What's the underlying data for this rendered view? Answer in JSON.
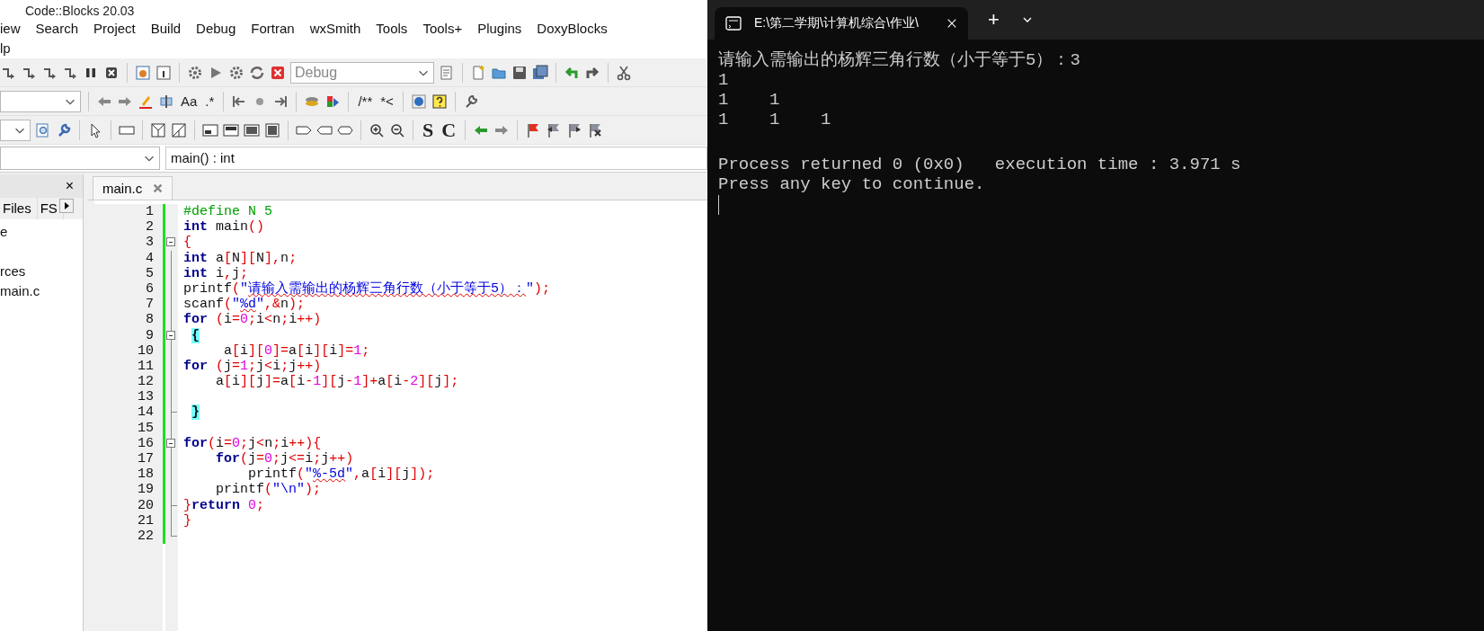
{
  "window": {
    "title": "Code::Blocks 20.03"
  },
  "menu": {
    "items": [
      "iew",
      "Search",
      "Project",
      "Build",
      "Debug",
      "Fortran",
      "wxSmith",
      "Tools",
      "Tools+",
      "Plugins",
      "DoxyBlocks"
    ],
    "second_row": [
      "lp"
    ]
  },
  "toolbars": [
    {
      "texts": [
        "Debug"
      ]
    },
    {
      "texts": [
        "Aa",
        ".*",
        "/**",
        "*<"
      ]
    },
    {
      "texts": [
        "S",
        "C"
      ]
    }
  ],
  "function_field": {
    "value": "main() : int"
  },
  "management": {
    "close_glyph": "×",
    "tabs": [
      {
        "label": "Files",
        "selected": false
      },
      {
        "label": "FS",
        "selected": false
      }
    ],
    "tree": [
      "e",
      "rces",
      "main.c"
    ]
  },
  "editor": {
    "tab": {
      "label": "main.c",
      "selected": true
    },
    "lines": [
      {
        "number": "1",
        "segs": [
          {
            "kind": "pp",
            "text": "#define N 5"
          }
        ]
      },
      {
        "number": "2",
        "segs": [
          {
            "kind": "kw",
            "text": "int"
          },
          {
            "kind": "id",
            "text": " main"
          },
          {
            "kind": "op",
            "text": "()"
          }
        ]
      },
      {
        "number": "3",
        "fold_start": true,
        "segs": [
          {
            "kind": "op",
            "text": "{"
          }
        ]
      },
      {
        "number": "4",
        "segs": [
          {
            "kind": "kw",
            "text": "int"
          },
          {
            "kind": "id",
            "text": " a"
          },
          {
            "kind": "op",
            "text": "["
          },
          {
            "kind": "id",
            "text": "N"
          },
          {
            "kind": "op",
            "text": "]["
          },
          {
            "kind": "id",
            "text": "N"
          },
          {
            "kind": "op",
            "text": "],"
          },
          {
            "kind": "id",
            "text": "n"
          },
          {
            "kind": "op",
            "text": ";"
          }
        ]
      },
      {
        "number": "5",
        "segs": [
          {
            "kind": "kw",
            "text": "int"
          },
          {
            "kind": "id",
            "text": " i"
          },
          {
            "kind": "op",
            "text": ","
          },
          {
            "kind": "id",
            "text": "j"
          },
          {
            "kind": "op",
            "text": ";"
          }
        ]
      },
      {
        "number": "6",
        "segs": [
          {
            "kind": "id",
            "text": "printf"
          },
          {
            "kind": "op",
            "text": "("
          },
          {
            "kind": "str",
            "text": "\""
          },
          {
            "kind": "flag",
            "text": "请输入需输出的杨辉三角行数（小于等于5）："
          },
          {
            "kind": "str",
            "text": "\""
          },
          {
            "kind": "op",
            "text": ");"
          }
        ]
      },
      {
        "number": "7",
        "segs": [
          {
            "kind": "id",
            "text": "scanf"
          },
          {
            "kind": "op",
            "text": "("
          },
          {
            "kind": "str",
            "text": "\""
          },
          {
            "kind": "flag",
            "text": "%d"
          },
          {
            "kind": "str",
            "text": "\""
          },
          {
            "kind": "op",
            "text": ",&"
          },
          {
            "kind": "id",
            "text": "n"
          },
          {
            "kind": "op",
            "text": ");"
          }
        ]
      },
      {
        "number": "8",
        "segs": [
          {
            "kind": "kw",
            "text": "for"
          },
          {
            "kind": "op",
            "text": " ("
          },
          {
            "kind": "id",
            "text": "i"
          },
          {
            "kind": "op",
            "text": "="
          },
          {
            "kind": "num",
            "text": "0"
          },
          {
            "kind": "op",
            "text": ";"
          },
          {
            "kind": "id",
            "text": "i"
          },
          {
            "kind": "op",
            "text": "<"
          },
          {
            "kind": "id",
            "text": "n"
          },
          {
            "kind": "op",
            "text": ";"
          },
          {
            "kind": "id",
            "text": "i"
          },
          {
            "kind": "op",
            "text": "++)"
          }
        ]
      },
      {
        "number": "9",
        "fold_start": true,
        "segs": [
          {
            "kind": "brace",
            "text": "{"
          }
        ]
      },
      {
        "number": "10",
        "segs": [
          {
            "kind": "id",
            "text": "     a"
          },
          {
            "kind": "op",
            "text": "["
          },
          {
            "kind": "id",
            "text": "i"
          },
          {
            "kind": "op",
            "text": "]["
          },
          {
            "kind": "num",
            "text": "0"
          },
          {
            "kind": "op",
            "text": "]="
          },
          {
            "kind": "id",
            "text": "a"
          },
          {
            "kind": "op",
            "text": "["
          },
          {
            "kind": "id",
            "text": "i"
          },
          {
            "kind": "op",
            "text": "]["
          },
          {
            "kind": "id",
            "text": "i"
          },
          {
            "kind": "op",
            "text": "]="
          },
          {
            "kind": "num",
            "text": "1"
          },
          {
            "kind": "op",
            "text": ";"
          }
        ]
      },
      {
        "number": "11",
        "segs": [
          {
            "kind": "kw",
            "text": "for"
          },
          {
            "kind": "op",
            "text": " ("
          },
          {
            "kind": "id",
            "text": "j"
          },
          {
            "kind": "op",
            "text": "="
          },
          {
            "kind": "num",
            "text": "1"
          },
          {
            "kind": "op",
            "text": ";"
          },
          {
            "kind": "id",
            "text": "j"
          },
          {
            "kind": "op",
            "text": "<"
          },
          {
            "kind": "id",
            "text": "i"
          },
          {
            "kind": "op",
            "text": ";"
          },
          {
            "kind": "id",
            "text": "j"
          },
          {
            "kind": "op",
            "text": "++)"
          }
        ]
      },
      {
        "number": "12",
        "segs": [
          {
            "kind": "id",
            "text": "    a"
          },
          {
            "kind": "op",
            "text": "["
          },
          {
            "kind": "id",
            "text": "i"
          },
          {
            "kind": "op",
            "text": "]["
          },
          {
            "kind": "id",
            "text": "j"
          },
          {
            "kind": "op",
            "text": "]="
          },
          {
            "kind": "id",
            "text": "a"
          },
          {
            "kind": "op",
            "text": "["
          },
          {
            "kind": "id",
            "text": "i"
          },
          {
            "kind": "op",
            "text": "-"
          },
          {
            "kind": "num",
            "text": "1"
          },
          {
            "kind": "op",
            "text": "]["
          },
          {
            "kind": "id",
            "text": "j"
          },
          {
            "kind": "op",
            "text": "-"
          },
          {
            "kind": "num",
            "text": "1"
          },
          {
            "kind": "op",
            "text": "]+"
          },
          {
            "kind": "id",
            "text": "a"
          },
          {
            "kind": "op",
            "text": "["
          },
          {
            "kind": "id",
            "text": "i"
          },
          {
            "kind": "op",
            "text": "-"
          },
          {
            "kind": "num",
            "text": "2"
          },
          {
            "kind": "op",
            "text": "]["
          },
          {
            "kind": "id",
            "text": "j"
          },
          {
            "kind": "op",
            "text": "];"
          }
        ]
      },
      {
        "number": "13"
      },
      {
        "number": "14",
        "fold_end": true,
        "segs": [
          {
            "kind": "brace",
            "text": "}"
          }
        ]
      },
      {
        "number": "15"
      },
      {
        "number": "16",
        "fold_start": true,
        "segs": [
          {
            "kind": "kw",
            "text": "for"
          },
          {
            "kind": "op",
            "text": "("
          },
          {
            "kind": "id",
            "text": "i"
          },
          {
            "kind": "op",
            "text": "="
          },
          {
            "kind": "num",
            "text": "0"
          },
          {
            "kind": "op",
            "text": ";"
          },
          {
            "kind": "id",
            "text": "j"
          },
          {
            "kind": "op",
            "text": "<"
          },
          {
            "kind": "id",
            "text": "n"
          },
          {
            "kind": "op",
            "text": ";"
          },
          {
            "kind": "id",
            "text": "i"
          },
          {
            "kind": "op",
            "text": "++){"
          }
        ]
      },
      {
        "number": "17",
        "segs": [
          {
            "kind": "kw",
            "text": "    for"
          },
          {
            "kind": "op",
            "text": "("
          },
          {
            "kind": "id",
            "text": "j"
          },
          {
            "kind": "op",
            "text": "="
          },
          {
            "kind": "num",
            "text": "0"
          },
          {
            "kind": "op",
            "text": ";"
          },
          {
            "kind": "id",
            "text": "j"
          },
          {
            "kind": "op",
            "text": "<="
          },
          {
            "kind": "id",
            "text": "i"
          },
          {
            "kind": "op",
            "text": ";"
          },
          {
            "kind": "id",
            "text": "j"
          },
          {
            "kind": "op",
            "text": "++)"
          }
        ]
      },
      {
        "number": "18",
        "segs": [
          {
            "kind": "id",
            "text": "        printf"
          },
          {
            "kind": "op",
            "text": "("
          },
          {
            "kind": "str",
            "text": "\""
          },
          {
            "kind": "flag",
            "text": "%-5d"
          },
          {
            "kind": "str",
            "text": "\""
          },
          {
            "kind": "op",
            "text": ","
          },
          {
            "kind": "id",
            "text": "a"
          },
          {
            "kind": "op",
            "text": "["
          },
          {
            "kind": "id",
            "text": "i"
          },
          {
            "kind": "op",
            "text": "]["
          },
          {
            "kind": "id",
            "text": "j"
          },
          {
            "kind": "op",
            "text": "]);"
          }
        ]
      },
      {
        "number": "19",
        "segs": [
          {
            "kind": "id",
            "text": "    printf"
          },
          {
            "kind": "op",
            "text": "("
          },
          {
            "kind": "str",
            "text": "\"\\n\""
          },
          {
            "kind": "op",
            "text": ");"
          }
        ]
      },
      {
        "number": "20",
        "fold_end": true,
        "segs": [
          {
            "kind": "op",
            "text": "}"
          },
          {
            "kind": "kw",
            "text": "return"
          },
          {
            "kind": "num",
            "text": " 0"
          },
          {
            "kind": "op",
            "text": ";"
          }
        ]
      },
      {
        "number": "21",
        "segs": [
          {
            "kind": "op",
            "text": "}"
          }
        ]
      },
      {
        "number": "22",
        "fold_end": true
      }
    ]
  },
  "terminal": {
    "tab": {
      "title": "E:\\第二学期\\计算机综合\\作业\\",
      "selected": true
    },
    "new_tab": "+",
    "lines": [
      "请输入需输出的杨辉三角行数（小于等于5）：3",
      "1",
      "1    1",
      "1    1    1",
      "Process returned 0 (0x0)   execution time : 3.971 s",
      "Press any key to continue."
    ]
  }
}
